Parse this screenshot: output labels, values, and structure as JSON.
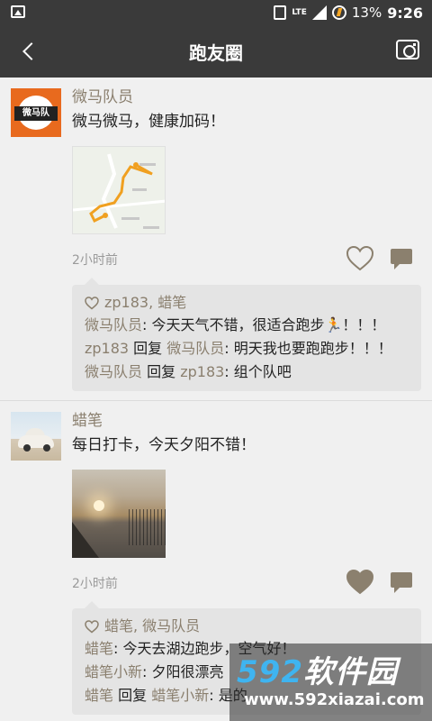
{
  "status_bar": {
    "icons": [
      "image-icon",
      "vibrate-icon",
      "lte-icon",
      "signal-icon",
      "charging-icon"
    ],
    "network": "LTE",
    "battery": "13%",
    "time": "9:26"
  },
  "navbar": {
    "title": "跑友圈",
    "back_icon": "back-arrow-icon",
    "camera_icon": "camera-icon"
  },
  "posts": [
    {
      "author": "微马队员",
      "avatar": "orange-team-logo",
      "avatar_text": "微马队",
      "text": "微马微马，健康加码！",
      "image": "route-map",
      "time_ago": "2小时前",
      "liked": false,
      "likes": "zp183, 蜡笔",
      "comments": [
        {
          "user": "微马队员",
          "reply_to": "",
          "text": ": 今天天气不错，很适合跑步🏃！！！"
        },
        {
          "user": "zp183",
          "reply_word": " 回复 ",
          "reply_to": "微马队员",
          "text": ": 明天我也要跑跑步！！！"
        },
        {
          "user": "微马队员",
          "reply_word": " 回复 ",
          "reply_to": "zp183",
          "text": ": 组个队吧"
        }
      ]
    },
    {
      "author": "蜡笔",
      "avatar": "vintage-car-photo",
      "text": "每日打卡，今天夕阳不错！",
      "image": "sunset-lake-photo",
      "time_ago": "2小时前",
      "liked": true,
      "likes": "蜡笔, 微马队员",
      "comments": [
        {
          "user": "蜡笔",
          "reply_to": "",
          "text": ": 今天去湖边跑步，空气好！"
        },
        {
          "user": "蜡笔小新",
          "reply_to": "",
          "text": ": 夕阳很漂亮"
        },
        {
          "user": "蜡笔",
          "reply_word": " 回复 ",
          "reply_to": "蜡笔小新",
          "text": ": 是的"
        }
      ]
    }
  ],
  "colors": {
    "bar": "#3a3a3a",
    "username": "#8a7f6e",
    "comment_box": "#e4e4e4",
    "background": "#f0f0f0",
    "accent_orange": "#e86a1e"
  },
  "watermark": {
    "brand_num": "592",
    "brand_text": "软件园",
    "url": "www.592xiazai.com"
  }
}
